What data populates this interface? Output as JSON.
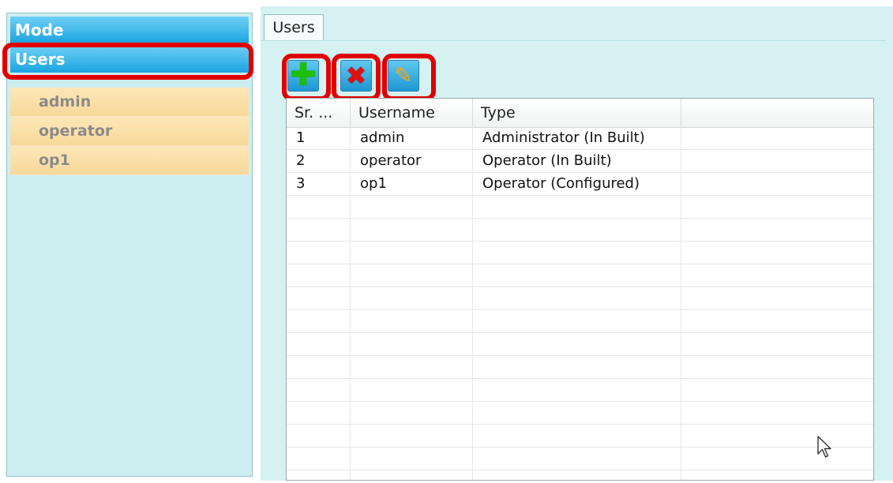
{
  "sidebar": {
    "mode_label": "Mode",
    "users_label": "Users",
    "user_items": [
      "admin",
      "operator",
      "op1"
    ]
  },
  "tab": {
    "label": "Users"
  },
  "toolbar": {
    "add": {
      "icon": "plus-icon",
      "symbol": "✚"
    },
    "delete": {
      "icon": "close-icon",
      "symbol": "✖"
    },
    "edit": {
      "icon": "pencil-icon",
      "symbol": "✎"
    }
  },
  "table": {
    "headers": [
      "Sr. ...",
      "Username",
      "Type",
      ""
    ],
    "rows": [
      [
        "1",
        "admin",
        "Administrator (In Built)",
        ""
      ],
      [
        "2",
        "operator",
        "Operator (In Built)",
        ""
      ],
      [
        "3",
        "op1",
        "Operator (Configured)",
        ""
      ]
    ],
    "empty_rows": 13
  },
  "colors": {
    "highlight": "#e10000",
    "panel_bg": "#cdeef0",
    "header_blue": "#1aa3e0",
    "user_item_bg": "#fde7b8"
  }
}
